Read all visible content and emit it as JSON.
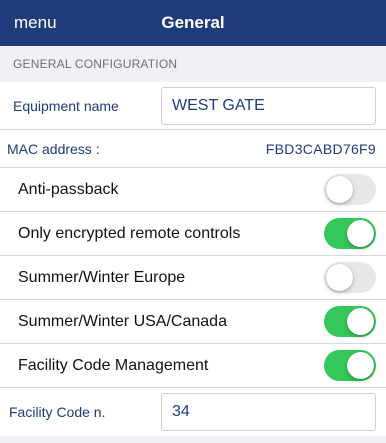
{
  "navbar": {
    "menu_label": "menu",
    "title": "General"
  },
  "section": {
    "header": "GENERAL CONFIGURATION"
  },
  "equipment": {
    "label": "Equipment name",
    "value": "WEST GATE"
  },
  "mac": {
    "label": "MAC address :",
    "value": "FBD3CABD76F9"
  },
  "toggles": [
    {
      "label": "Anti-passback",
      "on": false
    },
    {
      "label": "Only encrypted remote controls",
      "on": true
    },
    {
      "label": "Summer/Winter Europe",
      "on": false
    },
    {
      "label": "Summer/Winter USA/Canada",
      "on": true
    },
    {
      "label": "Facility Code Management",
      "on": true
    }
  ],
  "facility_code": {
    "label": "Facility Code n.",
    "value": "34"
  },
  "colors": {
    "navbar": "#1f3c7a",
    "switch_on": "#34c759",
    "switch_off": "#e7e7ea",
    "label_blue": "#1f3c7a"
  }
}
